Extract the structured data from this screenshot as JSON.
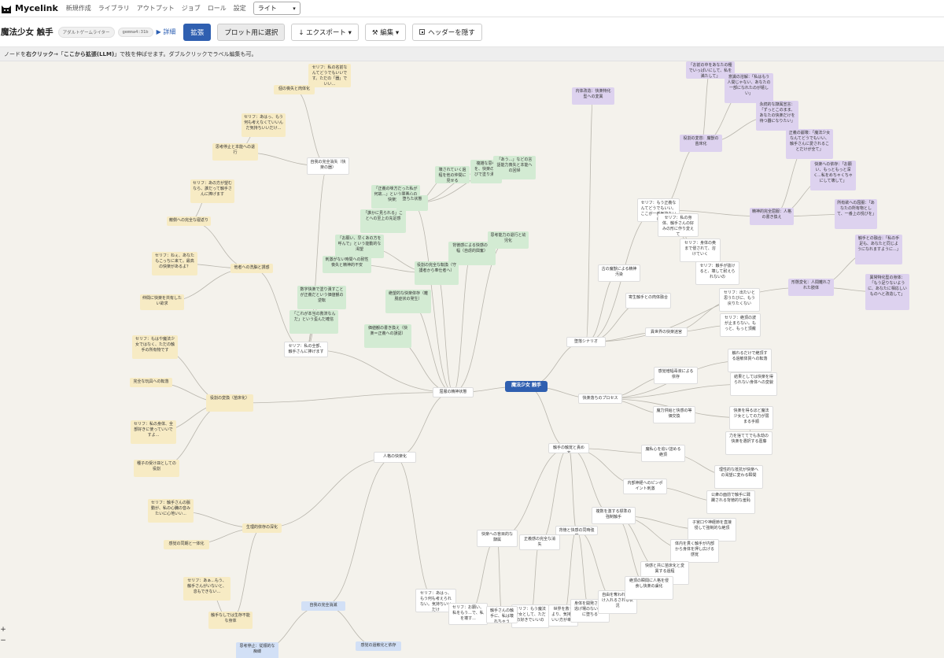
{
  "app": {
    "name": "Mycelink",
    "nav": [
      "新規作成",
      "ライブラリ",
      "アウトプット",
      "ジョブ",
      "ロール",
      "設定"
    ],
    "theme_value": "ライト"
  },
  "toolbar": {
    "title": "魔法少女 触手",
    "badge_role": "アダルトゲームライター",
    "badge_model": "gemma4:31b",
    "detail": "▶ 詳細",
    "expand": "拡張",
    "select_plot": "プロット用に選択",
    "export": "↓ エクスポート ▾",
    "edit": "⚒ 編集 ▾",
    "hide_header": "ヘッダーを隠す"
  },
  "hint": {
    "part1": "ノードを",
    "bold1": "右クリック",
    "part2": " →「",
    "bold2": "ここから拡張(LLM)",
    "part3": "」で枝を伸ばせます。ダブルクリックでラベル編集も可。"
  },
  "zoom": {
    "plus": "+",
    "minus": "−"
  },
  "colors": {
    "accent": "#2f5fb0",
    "yellow": "#f7ebc4",
    "green": "#d3ebd3",
    "purple": "#ddd2ef",
    "blue": "#d2e0f6"
  },
  "nodes": [
    {
      "id": "root",
      "label": "魔法少女 触手"
    },
    {
      "id": "n1",
      "label": "屈服の精神状態"
    },
    {
      "id": "n2",
      "label": "触手の触覚と責め方"
    },
    {
      "id": "n3",
      "label": "快楽落ちのプロセス"
    },
    {
      "id": "n4",
      "label": "人格の快楽化"
    },
    {
      "id": "n5",
      "label": "堕落シナリオ"
    },
    {
      "id": "y1",
      "label": "セリフ：私の名前なんてどうでもいいです。ただの「器」でいい..."
    },
    {
      "id": "y2",
      "label": "個の喪失と肉体化"
    },
    {
      "id": "y3",
      "label": "セリフ：あはっ、もう何も考えなくていいんだ気持ちいいだけ..."
    },
    {
      "id": "y4",
      "label": "思考停止と本能への退行"
    },
    {
      "id": "y5",
      "label": "セリフ：あの方が望むなら、誰だって触手さんに捧げます"
    },
    {
      "id": "y6",
      "label": "敵側への完全な寝返り"
    },
    {
      "id": "y7",
      "label": "セリフ：ねぇ、あなたもこっちに来て。最高の快楽があるよ？"
    },
    {
      "id": "y8",
      "label": "他者への洗脳と誘惑"
    },
    {
      "id": "y9",
      "label": "仲間に快楽を共有したい欲求"
    },
    {
      "id": "y10",
      "label": "セリフ：もはや魔法少女ではなく、ただの触手の所有物です"
    },
    {
      "id": "y11",
      "label": "完全な玩具への転落"
    },
    {
      "id": "y12",
      "label": "役割の変換（苗床化）"
    },
    {
      "id": "y13",
      "label": "セリフ：私の身体、全部好きに使っていいですよ..."
    },
    {
      "id": "y14",
      "label": "種子の受け皿としての役割"
    },
    {
      "id": "y15",
      "label": "セリフ：触手さんの脈動が、私の心臓の音みたいに心地いい..."
    },
    {
      "id": "y16",
      "label": "生理的依存の深化"
    },
    {
      "id": "y17",
      "label": "感覚の同期と一体化"
    },
    {
      "id": "y18",
      "label": "セリフ：あぁ...もう、触手さんがいないと、息もできない..."
    },
    {
      "id": "y19",
      "label": "触手なしでは生存不能な身体"
    },
    {
      "id": "w1",
      "label": "自我の完全消失（快楽の器）"
    },
    {
      "id": "w2",
      "label": "セリフ：私の全部、触手さんに捧げます"
    },
    {
      "id": "w3",
      "label": "セリフ：あはっ、もう何も考えられない。気持ちいいだけ"
    },
    {
      "id": "w4",
      "label": "快楽への盲目的な隷属"
    },
    {
      "id": "w5",
      "label": "正義感の完全な消失"
    },
    {
      "id": "w6",
      "label": "背徳と快感の同時強度"
    },
    {
      "id": "w7",
      "label": "セリフ：もう魔法少女として、ただの好きでいいの"
    },
    {
      "id": "w8",
      "label": "世界を救うより、気持ちいい方が幸せ"
    },
    {
      "id": "w9",
      "label": "身体を開発され、逃げ場のない絶頂に堕ちる"
    },
    {
      "id": "w10",
      "label": "自由を奪われ、だけ入れるされる状況"
    },
    {
      "id": "w11",
      "label": "セリフ：お願い、私をもう...で、私を壊す..."
    },
    {
      "id": "w12",
      "label": "触手さんの触手に、私は壊れちゃう"
    },
    {
      "id": "g1",
      "label": "壊されていく過程を他の仲間に見せる"
    },
    {
      "id": "g2",
      "label": "複雑な思考を、快楽の喜びで塗り潰す"
    },
    {
      "id": "g3",
      "label": "「あう...」などの言語能力喪失と本能への回帰"
    },
    {
      "id": "g4",
      "label": "「正義の味方だった私が何故...」という罪悪心の快楽変換"
    },
    {
      "id": "g5",
      "label": "堕ちた状態"
    },
    {
      "id": "g6",
      "label": "「誰かに見られる」ことへの至上の充足感"
    },
    {
      "id": "g7",
      "label": "「お願い、早くあの方を呼んで」という能動的な渇望"
    },
    {
      "id": "g8",
      "label": "刺激がない時間への耐性喪失と精神的不安"
    },
    {
      "id": "g9",
      "label": "背徳感による快感の増幅（自虐的興奮）"
    },
    {
      "id": "g10",
      "label": "思考能力の退行と幼児化"
    },
    {
      "id": "g11",
      "label": "役割の完全な転換（守護者から奉仕者へ）"
    },
    {
      "id": "g12",
      "label": "数字快楽で塗り潰すことが正義だという価値観の逆転"
    },
    {
      "id": "g13",
      "label": "「これが本当の救済なんだ」という歪んだ確信"
    },
    {
      "id": "g14",
      "label": "絶望的な快楽依存（離脱症状の発生）"
    },
    {
      "id": "g15",
      "label": "価値観の書き換え（快楽＝正義への誤認）"
    },
    {
      "id": "w13",
      "label": "古の魔獣による精神汚染"
    },
    {
      "id": "w14",
      "label": "寄生触手との肉体融合"
    },
    {
      "id": "w15",
      "label": "異世界の快楽迷宮"
    },
    {
      "id": "w16",
      "label": "セリフ：もう正義なんてどうでもいい。ここが一番気持ちいい"
    },
    {
      "id": "w17",
      "label": "セリフ：私の身体、触手さんの好みの形に作り変えて"
    },
    {
      "id": "w18",
      "label": "セリフ：身体の奥まで侵されて、溶けていく"
    },
    {
      "id": "w19",
      "label": "セリフ：触手が抜けると、壊して耐えられないの"
    },
    {
      "id": "w20",
      "label": "セリフ：出たいと思うたびに、もう戻りたくない"
    },
    {
      "id": "w21",
      "label": "セリフ：絶頂の波が止まらない。もっと、もっと頂戴"
    },
    {
      "id": "w22",
      "label": "触れるだけで絶頂する過敏体質への転落"
    },
    {
      "id": "w23",
      "label": "感覚増幅毒液による依存"
    },
    {
      "id": "w24",
      "label": "結果としては快楽を得られない身体への変貌"
    },
    {
      "id": "w25",
      "label": "魔力供給と快感の等価交換"
    },
    {
      "id": "w26",
      "label": "快楽を得るほど魔法少女としての力が弱まる手順"
    },
    {
      "id": "w27",
      "label": "力を捨ててでも永劫の快楽を選択する葛藤"
    },
    {
      "id": "w28",
      "label": "魔私心を追い詰める絶頂"
    },
    {
      "id": "w29",
      "label": "理性的な抵抗が快楽への渇望に変わる瞬間"
    },
    {
      "id": "w30",
      "label": "内部神経へのピンポイント刺激"
    },
    {
      "id": "w31",
      "label": "公衆の面前で触手に蹂躙される背徳的な羞恥"
    },
    {
      "id": "w32",
      "label": "複数を激する標準の強制触手"
    },
    {
      "id": "w33",
      "label": "子宮口や神経節を直接侵して強制的な絶頂"
    },
    {
      "id": "w34",
      "label": "体内を貫く触手が内部から身体を押し広げる感覚"
    },
    {
      "id": "w35",
      "label": "快感と共に苗床化と変異する過程"
    },
    {
      "id": "w36",
      "label": "絶頂の瞬間に人格を侵食し快楽の虜化"
    },
    {
      "id": "p1",
      "label": "内体改造：快楽特化型への変異"
    },
    {
      "id": "p2",
      "label": "役割の変容：魔獣の苗床化"
    },
    {
      "id": "p3",
      "label": "「お前の中をあなたの種でいっぱいにして、私を満たして」"
    },
    {
      "id": "p4",
      "label": "意識の溶解：「私はもう人間じゃない、あなたの一部になれたのが嬉しい」"
    },
    {
      "id": "p5",
      "label": "永続的な隷属宣言：「ずっとこのまま、あなたの快楽だけを待つ器になりたい」"
    },
    {
      "id": "p6",
      "label": "正義の崩壊：「魔法少女なんてどうでもいい、触手さんに愛されることだけが全て」"
    },
    {
      "id": "p7",
      "label": "快楽への依存：「お願い、もっともっと深く...私をめちゃくちゃにして壊して」"
    },
    {
      "id": "p8",
      "label": "精神的完全屈服：人格の書き換え"
    },
    {
      "id": "p9",
      "label": "所有欲への屈服：「あなたの所有物として、一番上の悦びを」"
    },
    {
      "id": "p10",
      "label": "触手との融合：「私の手足も、あなたと同じようになれますように...」"
    },
    {
      "id": "p11",
      "label": "形態変化：人間離れされた肢体"
    },
    {
      "id": "p12",
      "label": "異常特化型の身体：「もう足りないように、あなたに相応しいものへと改造して」"
    },
    {
      "id": "b1",
      "label": "自我の完全消滅"
    },
    {
      "id": "b2",
      "label": "思考停止：従順的な痴縛"
    },
    {
      "id": "b3",
      "label": "感覚の過敏化と依存"
    }
  ]
}
